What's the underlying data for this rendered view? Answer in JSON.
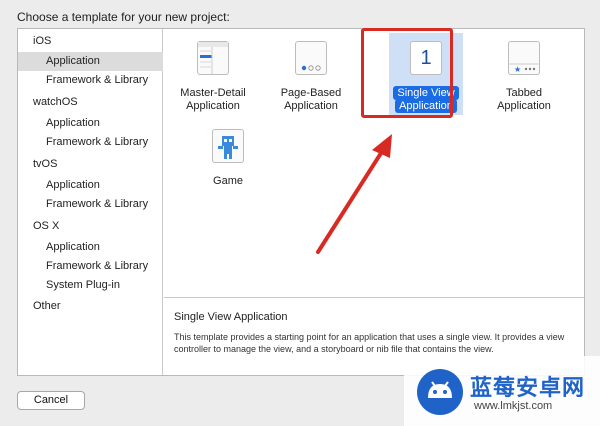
{
  "header": {
    "prompt": "Choose a template for your new project:"
  },
  "sidebar": {
    "items": [
      {
        "label": "iOS",
        "kind": "cat"
      },
      {
        "label": "Application",
        "kind": "sub",
        "selected": true
      },
      {
        "label": "Framework & Library",
        "kind": "sub"
      },
      {
        "label": "watchOS",
        "kind": "cat"
      },
      {
        "label": "Application",
        "kind": "sub"
      },
      {
        "label": "Framework & Library",
        "kind": "sub"
      },
      {
        "label": "tvOS",
        "kind": "cat"
      },
      {
        "label": "Application",
        "kind": "sub"
      },
      {
        "label": "Framework & Library",
        "kind": "sub"
      },
      {
        "label": "OS X",
        "kind": "cat"
      },
      {
        "label": "Application",
        "kind": "sub"
      },
      {
        "label": "Framework & Library",
        "kind": "sub"
      },
      {
        "label": "System Plug-in",
        "kind": "sub"
      },
      {
        "label": "Other",
        "kind": "cat"
      }
    ]
  },
  "templates": [
    {
      "line1": "Master-Detail",
      "line2": "Application",
      "icon": "master-detail-icon"
    },
    {
      "line1": "Page-Based",
      "line2": "Application",
      "icon": "page-based-icon"
    },
    {
      "line1": "Single View",
      "line2": "Application",
      "icon": "single-view-icon",
      "selected": true,
      "icon_text": "1"
    },
    {
      "line1": "Tabbed",
      "line2": "Application",
      "icon": "tabbed-icon"
    },
    {
      "line1": "Game",
      "line2": "",
      "icon": "game-icon"
    }
  ],
  "description": {
    "title": "Single View Application",
    "body": "This template provides a starting point for an application that uses a single view. It provides a view controller to manage the view, and a storyboard or nib file that contains the view."
  },
  "footer": {
    "cancel_label": "Cancel"
  },
  "annotation": {
    "box_color": "#d82a22",
    "arrow_color": "#d82a22"
  },
  "watermark": {
    "title": "蓝莓安卓网",
    "url": "www.lmkjst.com"
  },
  "colors": {
    "selection": "#1b6ce4",
    "selection_bg": "#cfe0f6"
  }
}
